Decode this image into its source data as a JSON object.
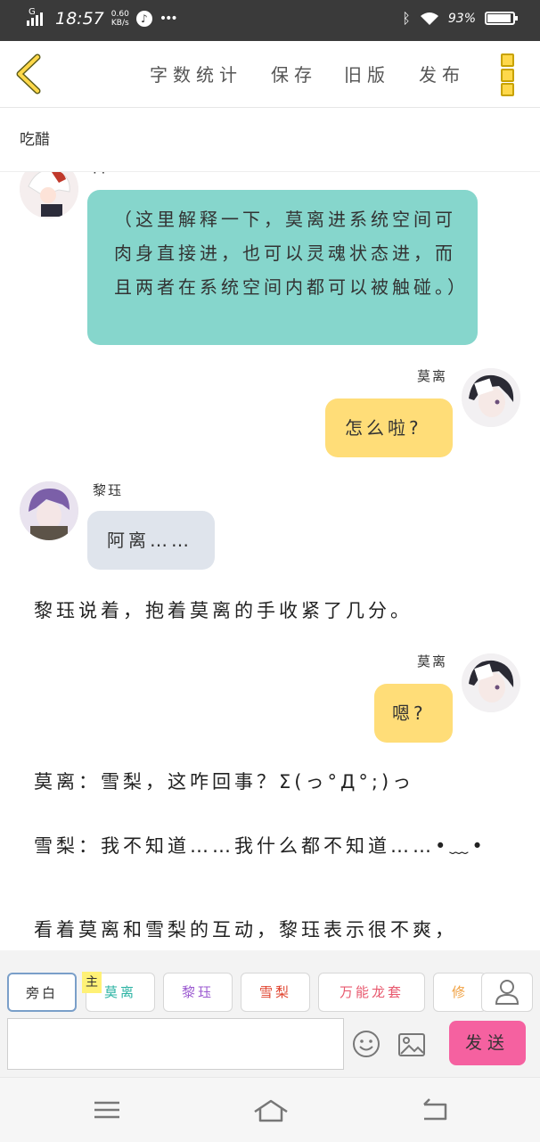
{
  "status_bar": {
    "network": "G",
    "time": "18:57",
    "speed_value": "0.60",
    "speed_unit": "KB/s",
    "dots": "•••",
    "battery_text": "93%",
    "battery_level": 0.93
  },
  "toolbar": {
    "word_count": "字数统计",
    "save": "保存",
    "old_version": "旧版",
    "publish": "发布"
  },
  "chapter_title": "吃醋",
  "messages": [
    {
      "type": "bubble",
      "side": "left",
      "speaker": "",
      "avatar": "white-hair-avatar",
      "text": "（这里解释一下，莫离进系统空间可肉身直接进，也可以灵魂状态进，而且两者在系统空间内都可以被触碰。）",
      "color": "#86d6cc"
    },
    {
      "type": "bubble",
      "side": "right",
      "speaker": "莫离",
      "avatar": "mo-li-avatar",
      "text": "怎么啦?",
      "color": "#ffdd78"
    },
    {
      "type": "bubble",
      "side": "left",
      "speaker": "黎珏",
      "avatar": "li-jue-avatar",
      "text": "阿离……",
      "color": "#dfe4ec"
    },
    {
      "type": "narration",
      "text": "黎珏说着，抱着莫离的手收紧了几分。"
    },
    {
      "type": "bubble",
      "side": "right",
      "speaker": "莫离",
      "avatar": "mo-li-avatar",
      "text": "嗯?",
      "color": "#ffdd78"
    },
    {
      "type": "narration",
      "text": "莫离：雪梨，这咋回事？Σ(っ°Д°;)っ"
    },
    {
      "type": "narration",
      "text": "雪梨：我不知道……我什么都不知道……•﹏•"
    },
    {
      "type": "narration",
      "text": "看着莫离和雪梨的互动，黎珏表示很不爽，"
    }
  ],
  "roles": [
    {
      "label": "旁白",
      "color": "#333333"
    },
    {
      "label": "莫离",
      "color": "#2bb3a3"
    },
    {
      "label": "黎珏",
      "color": "#9b59d0"
    },
    {
      "label": "雪梨",
      "color": "#e0442f"
    },
    {
      "label": "万能龙套",
      "color": "#e85a6f"
    },
    {
      "label": "修",
      "color": "#f0a040"
    }
  ],
  "main_tag": "主",
  "input": {
    "value": "",
    "placeholder": ""
  },
  "send_label": "发送"
}
